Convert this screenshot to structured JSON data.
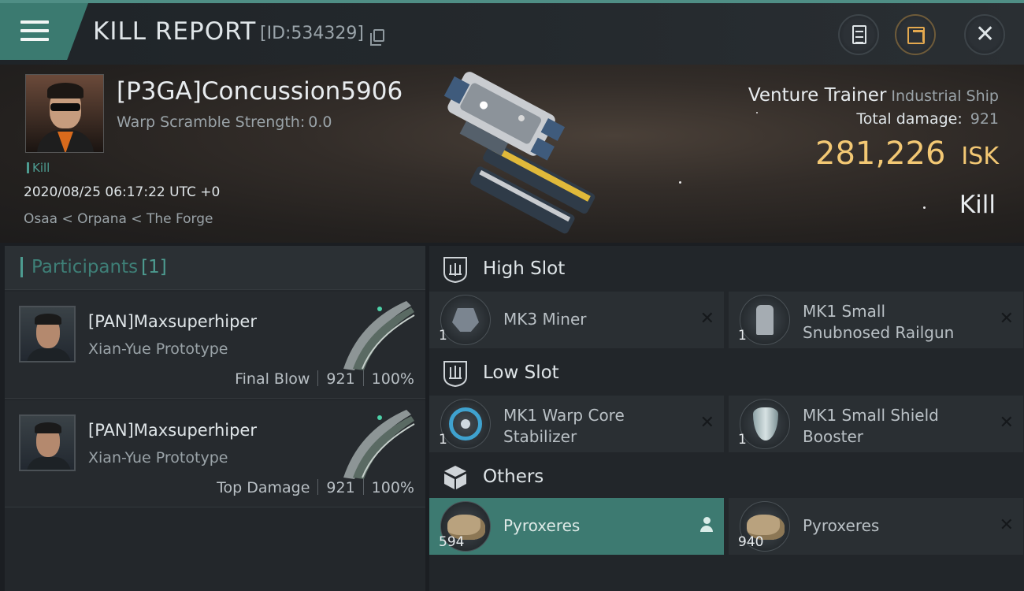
{
  "header": {
    "title": "KILL REPORT",
    "report_id": "[ID:534329]"
  },
  "buttons": {
    "menu_icon": "hamburger-icon",
    "clipboard_icon": "clipboard-icon",
    "share_icon": "share-icon",
    "close_icon": "close-icon",
    "close_glyph": "✕"
  },
  "victim": {
    "pilot": "[P3GA]Concussion5906",
    "warp_label": "Warp Scramble Strength:",
    "warp_value": "0.0",
    "tag": "Kill",
    "timestamp": "2020/08/25 06:17:22 UTC +0",
    "location": "Osaa < Orpana < The Forge",
    "ship_name": "Venture Trainer",
    "ship_class": "Industrial Ship",
    "total_damage_label": "Total damage:",
    "total_damage": "921",
    "isk_value": "281,226",
    "isk_unit": "ISK",
    "result": "Kill"
  },
  "participants": {
    "label": "Participants",
    "count": "[1]",
    "rows": [
      {
        "name": "[PAN]Maxsuperhiper",
        "ship": "Xian-Yue Prototype",
        "role": "Final Blow",
        "damage": "921",
        "percent": "100%"
      },
      {
        "name": "[PAN]Maxsuperhiper",
        "ship": "Xian-Yue Prototype",
        "role": "Top Damage",
        "damage": "921",
        "percent": "100%"
      }
    ]
  },
  "fitting": {
    "high_slot": {
      "label": "High Slot",
      "modules": [
        {
          "name": "MK3 Miner",
          "qty": "1"
        },
        {
          "name_line1": "MK1 Small",
          "name_line2": "Snubnosed Railgun",
          "qty": "1"
        }
      ]
    },
    "low_slot": {
      "label": "Low Slot",
      "modules": [
        {
          "name_line1": "MK1 Warp Core",
          "name_line2": "Stabilizer",
          "qty": "1"
        },
        {
          "name_line1": "MK1 Small Shield",
          "name_line2": "Booster",
          "qty": "1"
        }
      ]
    },
    "others": {
      "label": "Others",
      "modules": [
        {
          "name": "Pyroxeres",
          "qty": "594",
          "selected": true
        },
        {
          "name": "Pyroxeres",
          "qty": "940"
        }
      ]
    },
    "remove_glyph": "✕"
  },
  "colors": {
    "accent": "#4d9c91",
    "selected_row": "#3d7a71",
    "isk": "#f3c874"
  }
}
